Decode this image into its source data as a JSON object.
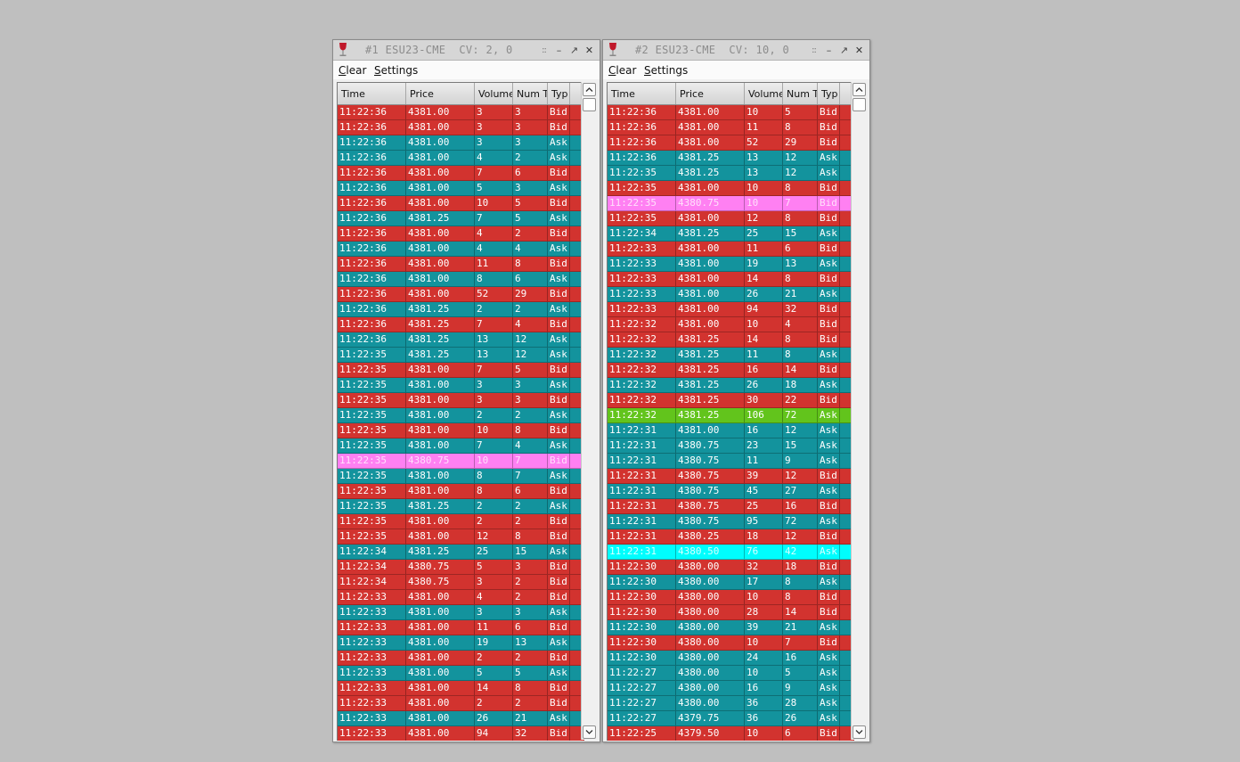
{
  "windows": [
    {
      "title": "#1 ESU23-CME  CV: 2, 0",
      "menu": {
        "clear": "Clear",
        "settings": "Settings"
      },
      "columns": [
        "Time",
        "Price",
        "Volume",
        "Num Tr",
        "Typ",
        ""
      ],
      "rows": [
        {
          "time": "11:22:36",
          "price": "4381.00",
          "volume": "3",
          "num": "3",
          "type": "Bid",
          "style": "bid"
        },
        {
          "time": "11:22:36",
          "price": "4381.00",
          "volume": "3",
          "num": "3",
          "type": "Bid",
          "style": "bid"
        },
        {
          "time": "11:22:36",
          "price": "4381.00",
          "volume": "3",
          "num": "3",
          "type": "Ask",
          "style": "ask"
        },
        {
          "time": "11:22:36",
          "price": "4381.00",
          "volume": "4",
          "num": "2",
          "type": "Ask",
          "style": "ask"
        },
        {
          "time": "11:22:36",
          "price": "4381.00",
          "volume": "7",
          "num": "6",
          "type": "Bid",
          "style": "bid"
        },
        {
          "time": "11:22:36",
          "price": "4381.00",
          "volume": "5",
          "num": "3",
          "type": "Ask",
          "style": "ask"
        },
        {
          "time": "11:22:36",
          "price": "4381.00",
          "volume": "10",
          "num": "5",
          "type": "Bid",
          "style": "bid"
        },
        {
          "time": "11:22:36",
          "price": "4381.25",
          "volume": "7",
          "num": "5",
          "type": "Ask",
          "style": "ask"
        },
        {
          "time": "11:22:36",
          "price": "4381.00",
          "volume": "4",
          "num": "2",
          "type": "Bid",
          "style": "bid"
        },
        {
          "time": "11:22:36",
          "price": "4381.00",
          "volume": "4",
          "num": "4",
          "type": "Ask",
          "style": "ask"
        },
        {
          "time": "11:22:36",
          "price": "4381.00",
          "volume": "11",
          "num": "8",
          "type": "Bid",
          "style": "bid"
        },
        {
          "time": "11:22:36",
          "price": "4381.00",
          "volume": "8",
          "num": "6",
          "type": "Ask",
          "style": "ask"
        },
        {
          "time": "11:22:36",
          "price": "4381.00",
          "volume": "52",
          "num": "29",
          "type": "Bid",
          "style": "bid"
        },
        {
          "time": "11:22:36",
          "price": "4381.25",
          "volume": "2",
          "num": "2",
          "type": "Ask",
          "style": "ask"
        },
        {
          "time": "11:22:36",
          "price": "4381.25",
          "volume": "7",
          "num": "4",
          "type": "Bid",
          "style": "bid"
        },
        {
          "time": "11:22:36",
          "price": "4381.25",
          "volume": "13",
          "num": "12",
          "type": "Ask",
          "style": "ask"
        },
        {
          "time": "11:22:35",
          "price": "4381.25",
          "volume": "13",
          "num": "12",
          "type": "Ask",
          "style": "ask"
        },
        {
          "time": "11:22:35",
          "price": "4381.00",
          "volume": "7",
          "num": "5",
          "type": "Bid",
          "style": "bid"
        },
        {
          "time": "11:22:35",
          "price": "4381.00",
          "volume": "3",
          "num": "3",
          "type": "Ask",
          "style": "ask"
        },
        {
          "time": "11:22:35",
          "price": "4381.00",
          "volume": "3",
          "num": "3",
          "type": "Bid",
          "style": "bid"
        },
        {
          "time": "11:22:35",
          "price": "4381.00",
          "volume": "2",
          "num": "2",
          "type": "Ask",
          "style": "ask"
        },
        {
          "time": "11:22:35",
          "price": "4381.00",
          "volume": "10",
          "num": "8",
          "type": "Bid",
          "style": "bid"
        },
        {
          "time": "11:22:35",
          "price": "4381.00",
          "volume": "7",
          "num": "4",
          "type": "Ask",
          "style": "ask"
        },
        {
          "time": "11:22:35",
          "price": "4380.75",
          "volume": "10",
          "num": "7",
          "type": "Bid",
          "style": "pink"
        },
        {
          "time": "11:22:35",
          "price": "4381.00",
          "volume": "8",
          "num": "7",
          "type": "Ask",
          "style": "ask"
        },
        {
          "time": "11:22:35",
          "price": "4381.00",
          "volume": "8",
          "num": "6",
          "type": "Bid",
          "style": "bid"
        },
        {
          "time": "11:22:35",
          "price": "4381.25",
          "volume": "2",
          "num": "2",
          "type": "Ask",
          "style": "ask"
        },
        {
          "time": "11:22:35",
          "price": "4381.00",
          "volume": "2",
          "num": "2",
          "type": "Bid",
          "style": "bid"
        },
        {
          "time": "11:22:35",
          "price": "4381.00",
          "volume": "12",
          "num": "8",
          "type": "Bid",
          "style": "bid"
        },
        {
          "time": "11:22:34",
          "price": "4381.25",
          "volume": "25",
          "num": "15",
          "type": "Ask",
          "style": "ask"
        },
        {
          "time": "11:22:34",
          "price": "4380.75",
          "volume": "5",
          "num": "3",
          "type": "Bid",
          "style": "bid"
        },
        {
          "time": "11:22:34",
          "price": "4380.75",
          "volume": "3",
          "num": "2",
          "type": "Bid",
          "style": "bid"
        },
        {
          "time": "11:22:33",
          "price": "4381.00",
          "volume": "4",
          "num": "2",
          "type": "Bid",
          "style": "bid"
        },
        {
          "time": "11:22:33",
          "price": "4381.00",
          "volume": "3",
          "num": "3",
          "type": "Ask",
          "style": "ask"
        },
        {
          "time": "11:22:33",
          "price": "4381.00",
          "volume": "11",
          "num": "6",
          "type": "Bid",
          "style": "bid"
        },
        {
          "time": "11:22:33",
          "price": "4381.00",
          "volume": "19",
          "num": "13",
          "type": "Ask",
          "style": "ask"
        },
        {
          "time": "11:22:33",
          "price": "4381.00",
          "volume": "2",
          "num": "2",
          "type": "Bid",
          "style": "bid"
        },
        {
          "time": "11:22:33",
          "price": "4381.00",
          "volume": "5",
          "num": "5",
          "type": "Ask",
          "style": "ask"
        },
        {
          "time": "11:22:33",
          "price": "4381.00",
          "volume": "14",
          "num": "8",
          "type": "Bid",
          "style": "bid"
        },
        {
          "time": "11:22:33",
          "price": "4381.00",
          "volume": "2",
          "num": "2",
          "type": "Bid",
          "style": "bid"
        },
        {
          "time": "11:22:33",
          "price": "4381.00",
          "volume": "26",
          "num": "21",
          "type": "Ask",
          "style": "ask"
        },
        {
          "time": "11:22:33",
          "price": "4381.00",
          "volume": "94",
          "num": "32",
          "type": "Bid",
          "style": "bid"
        }
      ]
    },
    {
      "title": "#2 ESU23-CME  CV: 10, 0",
      "menu": {
        "clear": "Clear",
        "settings": "Settings"
      },
      "columns": [
        "Time",
        "Price",
        "Volume",
        "Num Tr",
        "Typ",
        ""
      ],
      "rows": [
        {
          "time": "11:22:36",
          "price": "4381.00",
          "volume": "10",
          "num": "5",
          "type": "Bid",
          "style": "bid"
        },
        {
          "time": "11:22:36",
          "price": "4381.00",
          "volume": "11",
          "num": "8",
          "type": "Bid",
          "style": "bid"
        },
        {
          "time": "11:22:36",
          "price": "4381.00",
          "volume": "52",
          "num": "29",
          "type": "Bid",
          "style": "bid"
        },
        {
          "time": "11:22:36",
          "price": "4381.25",
          "volume": "13",
          "num": "12",
          "type": "Ask",
          "style": "ask"
        },
        {
          "time": "11:22:35",
          "price": "4381.25",
          "volume": "13",
          "num": "12",
          "type": "Ask",
          "style": "ask"
        },
        {
          "time": "11:22:35",
          "price": "4381.00",
          "volume": "10",
          "num": "8",
          "type": "Bid",
          "style": "bid"
        },
        {
          "time": "11:22:35",
          "price": "4380.75",
          "volume": "10",
          "num": "7",
          "type": "Bid",
          "style": "pink"
        },
        {
          "time": "11:22:35",
          "price": "4381.00",
          "volume": "12",
          "num": "8",
          "type": "Bid",
          "style": "bid"
        },
        {
          "time": "11:22:34",
          "price": "4381.25",
          "volume": "25",
          "num": "15",
          "type": "Ask",
          "style": "ask"
        },
        {
          "time": "11:22:33",
          "price": "4381.00",
          "volume": "11",
          "num": "6",
          "type": "Bid",
          "style": "bid"
        },
        {
          "time": "11:22:33",
          "price": "4381.00",
          "volume": "19",
          "num": "13",
          "type": "Ask",
          "style": "ask"
        },
        {
          "time": "11:22:33",
          "price": "4381.00",
          "volume": "14",
          "num": "8",
          "type": "Bid",
          "style": "bid"
        },
        {
          "time": "11:22:33",
          "price": "4381.00",
          "volume": "26",
          "num": "21",
          "type": "Ask",
          "style": "ask"
        },
        {
          "time": "11:22:33",
          "price": "4381.00",
          "volume": "94",
          "num": "32",
          "type": "Bid",
          "style": "bid"
        },
        {
          "time": "11:22:32",
          "price": "4381.00",
          "volume": "10",
          "num": "4",
          "type": "Bid",
          "style": "bid"
        },
        {
          "time": "11:22:32",
          "price": "4381.25",
          "volume": "14",
          "num": "8",
          "type": "Bid",
          "style": "bid"
        },
        {
          "time": "11:22:32",
          "price": "4381.25",
          "volume": "11",
          "num": "8",
          "type": "Ask",
          "style": "ask"
        },
        {
          "time": "11:22:32",
          "price": "4381.25",
          "volume": "16",
          "num": "14",
          "type": "Bid",
          "style": "bid"
        },
        {
          "time": "11:22:32",
          "price": "4381.25",
          "volume": "26",
          "num": "18",
          "type": "Ask",
          "style": "ask"
        },
        {
          "time": "11:22:32",
          "price": "4381.25",
          "volume": "30",
          "num": "22",
          "type": "Bid",
          "style": "bid"
        },
        {
          "time": "11:22:32",
          "price": "4381.25",
          "volume": "106",
          "num": "72",
          "type": "Ask",
          "style": "green"
        },
        {
          "time": "11:22:31",
          "price": "4381.00",
          "volume": "16",
          "num": "12",
          "type": "Ask",
          "style": "ask"
        },
        {
          "time": "11:22:31",
          "price": "4380.75",
          "volume": "23",
          "num": "15",
          "type": "Ask",
          "style": "ask"
        },
        {
          "time": "11:22:31",
          "price": "4380.75",
          "volume": "11",
          "num": "9",
          "type": "Ask",
          "style": "ask"
        },
        {
          "time": "11:22:31",
          "price": "4380.75",
          "volume": "39",
          "num": "12",
          "type": "Bid",
          "style": "bid"
        },
        {
          "time": "11:22:31",
          "price": "4380.75",
          "volume": "45",
          "num": "27",
          "type": "Ask",
          "style": "ask"
        },
        {
          "time": "11:22:31",
          "price": "4380.75",
          "volume": "25",
          "num": "16",
          "type": "Bid",
          "style": "bid"
        },
        {
          "time": "11:22:31",
          "price": "4380.75",
          "volume": "95",
          "num": "72",
          "type": "Ask",
          "style": "ask"
        },
        {
          "time": "11:22:31",
          "price": "4380.25",
          "volume": "18",
          "num": "12",
          "type": "Bid",
          "style": "bid"
        },
        {
          "time": "11:22:31",
          "price": "4380.50",
          "volume": "76",
          "num": "42",
          "type": "Ask",
          "style": "cyan"
        },
        {
          "time": "11:22:30",
          "price": "4380.00",
          "volume": "32",
          "num": "18",
          "type": "Bid",
          "style": "bid"
        },
        {
          "time": "11:22:30",
          "price": "4380.00",
          "volume": "17",
          "num": "8",
          "type": "Ask",
          "style": "ask"
        },
        {
          "time": "11:22:30",
          "price": "4380.00",
          "volume": "10",
          "num": "8",
          "type": "Bid",
          "style": "bid"
        },
        {
          "time": "11:22:30",
          "price": "4380.00",
          "volume": "28",
          "num": "14",
          "type": "Bid",
          "style": "bid"
        },
        {
          "time": "11:22:30",
          "price": "4380.00",
          "volume": "39",
          "num": "21",
          "type": "Ask",
          "style": "ask"
        },
        {
          "time": "11:22:30",
          "price": "4380.00",
          "volume": "10",
          "num": "7",
          "type": "Bid",
          "style": "bid"
        },
        {
          "time": "11:22:30",
          "price": "4380.00",
          "volume": "24",
          "num": "16",
          "type": "Ask",
          "style": "ask"
        },
        {
          "time": "11:22:27",
          "price": "4380.00",
          "volume": "10",
          "num": "5",
          "type": "Ask",
          "style": "ask"
        },
        {
          "time": "11:22:27",
          "price": "4380.00",
          "volume": "16",
          "num": "9",
          "type": "Ask",
          "style": "ask"
        },
        {
          "time": "11:22:27",
          "price": "4380.00",
          "volume": "36",
          "num": "28",
          "type": "Ask",
          "style": "ask"
        },
        {
          "time": "11:22:27",
          "price": "4379.75",
          "volume": "36",
          "num": "26",
          "type": "Ask",
          "style": "ask"
        },
        {
          "time": "11:22:25",
          "price": "4379.50",
          "volume": "10",
          "num": "6",
          "type": "Bid",
          "style": "bid"
        }
      ]
    }
  ],
  "colors": {
    "bid": "#d2332f",
    "ask": "#13939d",
    "highlight_pink": "#ff80f2",
    "highlight_green": "#62c41c",
    "highlight_cyan": "#00fdfd",
    "background": "#bfbfbf"
  },
  "icons": {
    "app": "wine-glass-icon",
    "grip": "grip-icon",
    "minimize": "minimize-icon",
    "restore": "restore-icon",
    "close": "close-icon",
    "scroll_up": "chevron-up-icon",
    "scroll_down": "chevron-down-icon"
  },
  "titlebar_buttons": {
    "grip": "::",
    "minimize": "–",
    "restore": "↗",
    "close": "✕"
  }
}
